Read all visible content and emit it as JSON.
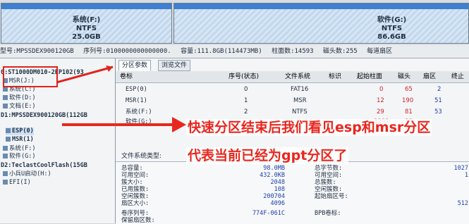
{
  "partitions": [
    {
      "label": "系统(F:)",
      "fs": "NTFS",
      "size": "25.0GB"
    },
    {
      "label": "软件(G:)",
      "fs": "NTFS",
      "size": "86.6GB"
    }
  ],
  "disk_info": {
    "model": "型号:MPSSDEX900120GB",
    "serial": "序列号:0100000000000000.",
    "capacity": "容量:111.8GB(114473MB)",
    "cylinders": "柱面数:14593",
    "heads": "磁头数:255",
    "sectors": "每道扇区"
  },
  "tree": [
    "0:ST1000DM010-2EP102(93",
    "MSR(J:)",
    "系统(C:)",
    "软件(D:)",
    "文档(E:)",
    "D1:MPSSDEX900120GB(112GB",
    "ESP(0)",
    "MSR(1)",
    "系统(F:)",
    "软件(G:)",
    "D2:TeclastCoolFlash(15GB",
    "小兵U启动(H:)",
    "EFI(I)"
  ],
  "tabs": [
    "分区参数",
    "浏览文件"
  ],
  "columns": [
    "卷标",
    "序号(状态)",
    "文件系统",
    "标识",
    "起始柱面",
    "磁头",
    "扇区",
    "终止"
  ],
  "rows": [
    {
      "label": "ESP(0)",
      "index": "0",
      "fs": "FAT16",
      "flag": "",
      "start_cyl": "0",
      "head": "65",
      "sector": "2"
    },
    {
      "label": "MSR(1)",
      "index": "1",
      "fs": "MSR",
      "flag": "",
      "start_cyl": "12",
      "head": "190",
      "sector": "51"
    },
    {
      "label": "系统(F:)",
      "index": "2",
      "fs": "NTFS",
      "flag": "",
      "start_cyl": "29",
      "head": "81",
      "sector": "53"
    },
    {
      "label": "软件(G:)",
      "index": "",
      "fs": "",
      "flag": "",
      "start_cyl": "3292",
      "head": "30",
      "sector": ""
    }
  ],
  "fs_type_label": "文件系统类型:",
  "stats_left": [
    {
      "label": "总容量:",
      "value": "98.0MB"
    },
    {
      "label": "可用空间:",
      "value": "432.0KB"
    },
    {
      "label": "簇大小:",
      "value": "2048"
    },
    {
      "label": "已用簇数:",
      "value": "108"
    },
    {
      "label": "空闲簇数:",
      "value": "200704"
    },
    {
      "label": "扇区大小:",
      "value": "4096"
    },
    {
      "label": "卷序列号:",
      "value": "774F-061C"
    },
    {
      "label": "保留扇区数:",
      "value": ""
    }
  ],
  "stats_right": [
    {
      "label": "总字节数:",
      "value": "1027"
    },
    {
      "label": "可用空间:",
      "value": "1"
    },
    {
      "label": "总簇数:",
      "value": ""
    },
    {
      "label": "空闲簇数:",
      "value": ""
    },
    {
      "label": "起始扇区号:",
      "value": ""
    },
    {
      "label": "",
      "value": "512"
    },
    {
      "label": "BPB卷标:",
      "value": ""
    }
  ],
  "annotation": {
    "line1": "快速分区结束后我们看见esp和msr分区",
    "line2": "代表当前已经为gpt分区了"
  },
  "colors": {
    "accent": "#3d7fd0",
    "annotation": "#e8271f"
  }
}
